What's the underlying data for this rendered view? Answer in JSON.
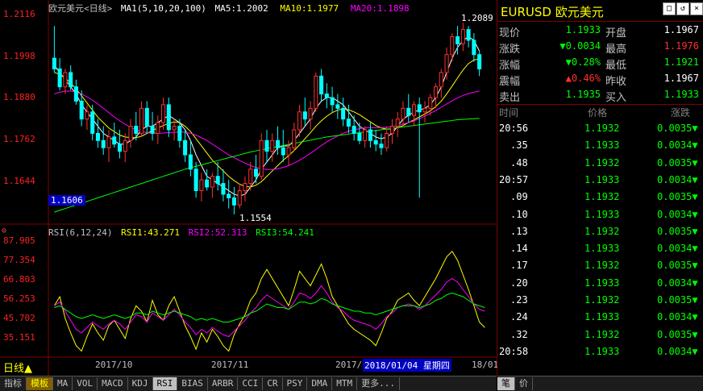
{
  "title": "欧元美元<日线>",
  "ma_legend": {
    "ma1": "MA1(5,10,20,100)",
    "ma5": "MA5:1.2002",
    "ma10": "MA10:1.1977",
    "ma20": "MA20:1.1898",
    "colors": {
      "ma5": "#ffffff",
      "ma10": "#ffff00",
      "ma20": "#ff00ff",
      "ma100": "#00ff00"
    }
  },
  "price_axis": [
    "1.2116",
    "1.1998",
    "1.1880",
    "1.1762",
    "1.1644"
  ],
  "current_tag": "1.1606",
  "high_label": "1.2089",
  "low_label": "1.1554",
  "rsi_legend": {
    "name": "RSI(6,12,24)",
    "rsi1": "RSI1:43.271",
    "rsi2": "RSI2:52.313",
    "rsi3": "RSI3:54.241"
  },
  "rsi_axis": [
    "87.905",
    "77.354",
    "66.803",
    "56.253",
    "45.702",
    "35.151"
  ],
  "x_labels": [
    "2017/10",
    "2017/11",
    "2017/",
    "18/01"
  ],
  "cursor_date": "2018/01/04 星期四",
  "period_button": "日线▲",
  "bottom_tabs": [
    "指标",
    "模板",
    "MA",
    "VOL",
    "MACD",
    "KDJ",
    "RSI",
    "BIAS",
    "ARBR",
    "CCI",
    "CR",
    "PSY",
    "DMA",
    "MTM",
    "更多..."
  ],
  "active_tab": "RSI",
  "right_bottom_tabs": [
    "笔",
    "价"
  ],
  "quote": {
    "symbol": "EURUSD",
    "name": "欧元美元",
    "rows": [
      {
        "l1": "现价",
        "v1": "1.1933",
        "c1": "#00ff00",
        "l2": "开盘",
        "v2": "1.1967",
        "c2": "#ffffff"
      },
      {
        "l1": "涨跌",
        "v1": "▼0.0034",
        "c1": "#00ff00",
        "l2": "最高",
        "v2": "1.1976",
        "c2": "#ff3030"
      },
      {
        "l1": "涨幅",
        "v1": "▼0.28%",
        "c1": "#00ff00",
        "l2": "最低",
        "v2": "1.1921",
        "c2": "#00ff00"
      },
      {
        "l1": "震幅",
        "v1": "▲0.46%",
        "c1": "#ff3030",
        "l2": "昨收",
        "v2": "1.1967",
        "c2": "#ffffff"
      },
      {
        "l1": "卖出",
        "v1": "1.1935",
        "c1": "#00ff00",
        "l2": "买入",
        "v2": "1.1933",
        "c2": "#00ff00"
      }
    ]
  },
  "ticks_header": {
    "time": "时间",
    "price": "价格",
    "change": "涨跌"
  },
  "ticks": [
    {
      "time": "20:56",
      "price": "1.1932",
      "change": "0.0035▼"
    },
    {
      "time": ".35",
      "price": "1.1933",
      "change": "0.0034▼"
    },
    {
      "time": ".48",
      "price": "1.1932",
      "change": "0.0035▼"
    },
    {
      "time": "20:57",
      "price": "1.1933",
      "change": "0.0034▼"
    },
    {
      "time": ".09",
      "price": "1.1932",
      "change": "0.0035▼"
    },
    {
      "time": ".10",
      "price": "1.1933",
      "change": "0.0034▼"
    },
    {
      "time": ".13",
      "price": "1.1932",
      "change": "0.0035▼"
    },
    {
      "time": ".14",
      "price": "1.1933",
      "change": "0.0034▼"
    },
    {
      "time": ".17",
      "price": "1.1932",
      "change": "0.0035▼"
    },
    {
      "time": ".20",
      "price": "1.1933",
      "change": "0.0034▼"
    },
    {
      "time": ".23",
      "price": "1.1932",
      "change": "0.0035▼"
    },
    {
      "time": ".24",
      "price": "1.1933",
      "change": "0.0034▼"
    },
    {
      "time": ".32",
      "price": "1.1932",
      "change": "0.0035▼"
    },
    {
      "time": "20:58",
      "price": "1.1933",
      "change": "0.0034▼"
    }
  ],
  "chart_data": {
    "type": "candlestick",
    "ylim": [
      1.154,
      1.213
    ],
    "candles": [
      [
        1.199,
        1.208,
        1.195,
        1.196
      ],
      [
        1.196,
        1.199,
        1.19,
        1.191
      ],
      [
        1.191,
        1.196,
        1.189,
        1.195
      ],
      [
        1.195,
        1.197,
        1.19,
        1.191
      ],
      [
        1.191,
        1.193,
        1.186,
        1.187
      ],
      [
        1.187,
        1.19,
        1.18,
        1.182
      ],
      [
        1.182,
        1.186,
        1.179,
        1.184
      ],
      [
        1.184,
        1.186,
        1.176,
        1.178
      ],
      [
        1.178,
        1.182,
        1.174,
        1.176
      ],
      [
        1.176,
        1.18,
        1.172,
        1.174
      ],
      [
        1.174,
        1.179,
        1.17,
        1.177
      ],
      [
        1.177,
        1.181,
        1.174,
        1.175
      ],
      [
        1.175,
        1.179,
        1.171,
        1.173
      ],
      [
        1.173,
        1.178,
        1.17,
        1.176
      ],
      [
        1.176,
        1.182,
        1.174,
        1.18
      ],
      [
        1.18,
        1.184,
        1.176,
        1.178
      ],
      [
        1.178,
        1.187,
        1.177,
        1.185
      ],
      [
        1.185,
        1.187,
        1.178,
        1.18
      ],
      [
        1.18,
        1.184,
        1.176,
        1.178
      ],
      [
        1.178,
        1.183,
        1.175,
        1.181
      ],
      [
        1.181,
        1.188,
        1.179,
        1.186
      ],
      [
        1.186,
        1.188,
        1.177,
        1.179
      ],
      [
        1.179,
        1.182,
        1.176,
        1.18
      ],
      [
        1.18,
        1.182,
        1.174,
        1.176
      ],
      [
        1.176,
        1.179,
        1.17,
        1.172
      ],
      [
        1.172,
        1.176,
        1.166,
        1.168
      ],
      [
        1.168,
        1.17,
        1.16,
        1.162
      ],
      [
        1.162,
        1.167,
        1.159,
        1.165
      ],
      [
        1.165,
        1.168,
        1.162,
        1.163
      ],
      [
        1.163,
        1.167,
        1.16,
        1.166
      ],
      [
        1.166,
        1.17,
        1.162,
        1.164
      ],
      [
        1.164,
        1.168,
        1.159,
        1.161
      ],
      [
        1.161,
        1.165,
        1.157,
        1.16
      ],
      [
        1.16,
        1.163,
        1.1554,
        1.158
      ],
      [
        1.158,
        1.164,
        1.157,
        1.162
      ],
      [
        1.162,
        1.166,
        1.159,
        1.164
      ],
      [
        1.164,
        1.17,
        1.162,
        1.168
      ],
      [
        1.168,
        1.172,
        1.164,
        1.166
      ],
      [
        1.166,
        1.178,
        1.165,
        1.176
      ],
      [
        1.176,
        1.179,
        1.17,
        1.173
      ],
      [
        1.173,
        1.178,
        1.17,
        1.176
      ],
      [
        1.176,
        1.18,
        1.172,
        1.174
      ],
      [
        1.174,
        1.179,
        1.17,
        1.172
      ],
      [
        1.172,
        1.176,
        1.169,
        1.174
      ],
      [
        1.174,
        1.181,
        1.173,
        1.179
      ],
      [
        1.179,
        1.186,
        1.177,
        1.184
      ],
      [
        1.184,
        1.188,
        1.18,
        1.182
      ],
      [
        1.182,
        1.187,
        1.179,
        1.185
      ],
      [
        1.185,
        1.195,
        1.184,
        1.194
      ],
      [
        1.194,
        1.196,
        1.187,
        1.189
      ],
      [
        1.189,
        1.192,
        1.185,
        1.188
      ],
      [
        1.188,
        1.191,
        1.184,
        1.186
      ],
      [
        1.186,
        1.189,
        1.182,
        1.185
      ],
      [
        1.185,
        1.188,
        1.18,
        1.182
      ],
      [
        1.182,
        1.186,
        1.178,
        1.18
      ],
      [
        1.18,
        1.183,
        1.176,
        1.178
      ],
      [
        1.178,
        1.181,
        1.175,
        1.176
      ],
      [
        1.176,
        1.18,
        1.174,
        1.179
      ],
      [
        1.179,
        1.181,
        1.174,
        1.176
      ],
      [
        1.176,
        1.179,
        1.173,
        1.175
      ],
      [
        1.175,
        1.178,
        1.172,
        1.174
      ],
      [
        1.174,
        1.18,
        1.173,
        1.178
      ],
      [
        1.178,
        1.182,
        1.175,
        1.18
      ],
      [
        1.18,
        1.184,
        1.177,
        1.182
      ],
      [
        1.182,
        1.187,
        1.18,
        1.185
      ],
      [
        1.185,
        1.189,
        1.181,
        1.183
      ],
      [
        1.183,
        1.187,
        1.18,
        1.186
      ],
      [
        1.186,
        1.188,
        1.16,
        1.184
      ],
      [
        1.184,
        1.187,
        1.181,
        1.185
      ],
      [
        1.185,
        1.189,
        1.183,
        1.188
      ],
      [
        1.188,
        1.192,
        1.185,
        1.191
      ],
      [
        1.191,
        1.196,
        1.188,
        1.195
      ],
      [
        1.195,
        1.202,
        1.193,
        1.2
      ],
      [
        1.2,
        1.206,
        1.198,
        1.205
      ],
      [
        1.205,
        1.208,
        1.2,
        1.203
      ],
      [
        1.203,
        1.2089,
        1.201,
        1.207
      ],
      [
        1.207,
        1.208,
        1.202,
        1.204
      ],
      [
        1.204,
        1.206,
        1.198,
        1.2
      ],
      [
        1.2,
        1.201,
        1.194,
        1.196
      ]
    ],
    "ma_series": [
      {
        "name": "MA5",
        "color": "#ffffff",
        "values": [
          1.197,
          1.195,
          1.193,
          1.191,
          1.189,
          1.186,
          1.184,
          1.182,
          1.18,
          1.178,
          1.177,
          1.176,
          1.175,
          1.175,
          1.176,
          1.177,
          1.179,
          1.18,
          1.18,
          1.181,
          1.182,
          1.183,
          1.182,
          1.181,
          1.179,
          1.176,
          1.172,
          1.169,
          1.166,
          1.165,
          1.164,
          1.163,
          1.162,
          1.161,
          1.1605,
          1.161,
          1.163,
          1.165,
          1.168,
          1.17,
          1.172,
          1.174,
          1.1745,
          1.1745,
          1.176,
          1.178,
          1.18,
          1.182,
          1.185,
          1.187,
          1.188,
          1.188,
          1.187,
          1.186,
          1.184,
          1.182,
          1.18,
          1.179,
          1.178,
          1.177,
          1.1765,
          1.177,
          1.178,
          1.18,
          1.182,
          1.183,
          1.184,
          1.1845,
          1.185,
          1.186,
          1.188,
          1.191,
          1.195,
          1.199,
          1.202,
          1.204,
          1.205,
          1.204,
          1.201
        ]
      },
      {
        "name": "MA10",
        "color": "#ffff00",
        "values": [
          1.195,
          1.1945,
          1.1935,
          1.192,
          1.1905,
          1.1885,
          1.1865,
          1.1845,
          1.1825,
          1.181,
          1.1795,
          1.1785,
          1.1775,
          1.177,
          1.1768,
          1.1768,
          1.1772,
          1.178,
          1.1788,
          1.1795,
          1.1802,
          1.1808,
          1.1812,
          1.181,
          1.18,
          1.1785,
          1.1765,
          1.1745,
          1.1725,
          1.1705,
          1.169,
          1.1675,
          1.166,
          1.1648,
          1.1638,
          1.1632,
          1.163,
          1.1635,
          1.1645,
          1.166,
          1.1675,
          1.169,
          1.1705,
          1.1718,
          1.1732,
          1.1748,
          1.1765,
          1.1782,
          1.18,
          1.1815,
          1.1828,
          1.1838,
          1.1845,
          1.1848,
          1.1846,
          1.184,
          1.1832,
          1.1822,
          1.1812,
          1.1802,
          1.1795,
          1.1792,
          1.1792,
          1.1796,
          1.1802,
          1.181,
          1.1818,
          1.1826,
          1.1834,
          1.1843,
          1.1855,
          1.187,
          1.189,
          1.1912,
          1.1935,
          1.1957,
          1.1975,
          1.1985,
          1.1988
        ]
      },
      {
        "name": "MA20",
        "color": "#ff00ff",
        "values": [
          1.189,
          1.1895,
          1.1898,
          1.1898,
          1.1895,
          1.189,
          1.1882,
          1.1873,
          1.1862,
          1.185,
          1.1838,
          1.1826,
          1.1815,
          1.1805,
          1.1797,
          1.179,
          1.1785,
          1.1782,
          1.178,
          1.178,
          1.1781,
          1.1782,
          1.1783,
          1.1784,
          1.1783,
          1.178,
          1.1775,
          1.1768,
          1.176,
          1.175,
          1.174,
          1.173,
          1.172,
          1.1712,
          1.1704,
          1.1697,
          1.169,
          1.1685,
          1.1681,
          1.1679,
          1.1679,
          1.1681,
          1.1685,
          1.169,
          1.1697,
          1.1705,
          1.1714,
          1.1724,
          1.1735,
          1.1746,
          1.1756,
          1.1765,
          1.1773,
          1.178,
          1.1786,
          1.179,
          1.1793,
          1.1795,
          1.1796,
          1.1796,
          1.1796,
          1.1797,
          1.1799,
          1.1802,
          1.1806,
          1.181,
          1.1815,
          1.1821,
          1.1828,
          1.1836,
          1.1844,
          1.1853,
          1.1862,
          1.1871,
          1.1879,
          1.1886,
          1.1891,
          1.1895,
          1.1898
        ]
      },
      {
        "name": "MA100",
        "color": "#00ff00",
        "values": [
          1.156,
          1.1565,
          1.157,
          1.1575,
          1.158,
          1.1585,
          1.159,
          1.1595,
          1.16,
          1.1605,
          1.161,
          1.1615,
          1.162,
          1.1625,
          1.163,
          1.1635,
          1.164,
          1.1645,
          1.165,
          1.1655,
          1.166,
          1.1665,
          1.167,
          1.1675,
          1.168,
          1.1684,
          1.1688,
          1.1692,
          1.1696,
          1.17,
          1.1704,
          1.1708,
          1.1712,
          1.1716,
          1.172,
          1.1724,
          1.1728,
          1.1731,
          1.1734,
          1.1737,
          1.174,
          1.1743,
          1.1746,
          1.1749,
          1.1752,
          1.1755,
          1.1758,
          1.1761,
          1.1764,
          1.1767,
          1.177,
          1.1772,
          1.1774,
          1.1776,
          1.1778,
          1.178,
          1.1782,
          1.1784,
          1.1786,
          1.1788,
          1.179,
          1.1792,
          1.1794,
          1.1796,
          1.1798,
          1.18,
          1.1802,
          1.1804,
          1.1806,
          1.1808,
          1.181,
          1.1812,
          1.1814,
          1.1816,
          1.1818,
          1.1819,
          1.182,
          1.1821,
          1.1822
        ]
      }
    ],
    "rsi_ylim": [
      28,
      92
    ],
    "rsi_series": [
      {
        "name": "RSI1",
        "color": "#ffff00",
        "values": [
          55,
          60,
          48,
          40,
          33,
          30,
          38,
          45,
          40,
          36,
          44,
          47,
          42,
          37,
          48,
          55,
          52,
          46,
          58,
          50,
          47,
          55,
          60,
          52,
          44,
          38,
          31,
          40,
          35,
          42,
          38,
          33,
          30,
          39,
          45,
          50,
          58,
          62,
          70,
          75,
          70,
          65,
          60,
          55,
          64,
          74,
          70,
          66,
          72,
          78,
          70,
          60,
          55,
          50,
          45,
          42,
          40,
          38,
          36,
          33,
          40,
          48,
          52,
          58,
          60,
          62,
          58,
          55,
          60,
          65,
          70,
          76,
          82,
          85,
          80,
          72,
          64,
          55,
          46,
          43
        ]
      },
      {
        "name": "RSI2",
        "color": "#ff00ff",
        "values": [
          55,
          57,
          52,
          47,
          42,
          40,
          43,
          46,
          44,
          42,
          45,
          47,
          45,
          42,
          46,
          50,
          49,
          46,
          51,
          49,
          47,
          50,
          53,
          50,
          46,
          43,
          39,
          42,
          40,
          43,
          41,
          39,
          38,
          41,
          44,
          47,
          51,
          54,
          58,
          61,
          59,
          57,
          55,
          53,
          57,
          62,
          61,
          59,
          62,
          66,
          62,
          57,
          54,
          52,
          49,
          47,
          46,
          45,
          44,
          42,
          45,
          49,
          51,
          54,
          55,
          56,
          55,
          53,
          55,
          58,
          61,
          64,
          68,
          70,
          68,
          64,
          60,
          56,
          53,
          52
        ]
      },
      {
        "name": "RSI3",
        "color": "#00ff00",
        "values": [
          54,
          55,
          53,
          51,
          49,
          48,
          49,
          50,
          49,
          48,
          49,
          50,
          49,
          48,
          49,
          51,
          51,
          50,
          52,
          51,
          50,
          51,
          52,
          51,
          50,
          49,
          47,
          48,
          47,
          48,
          47,
          46,
          46,
          47,
          48,
          49,
          51,
          52,
          54,
          56,
          55,
          54,
          54,
          53,
          55,
          57,
          57,
          56,
          57,
          59,
          58,
          56,
          55,
          54,
          53,
          52,
          52,
          51,
          51,
          50,
          51,
          52,
          53,
          54,
          55,
          55,
          55,
          54,
          55,
          56,
          58,
          59,
          61,
          62,
          61,
          60,
          58,
          56,
          55,
          54
        ]
      }
    ]
  }
}
